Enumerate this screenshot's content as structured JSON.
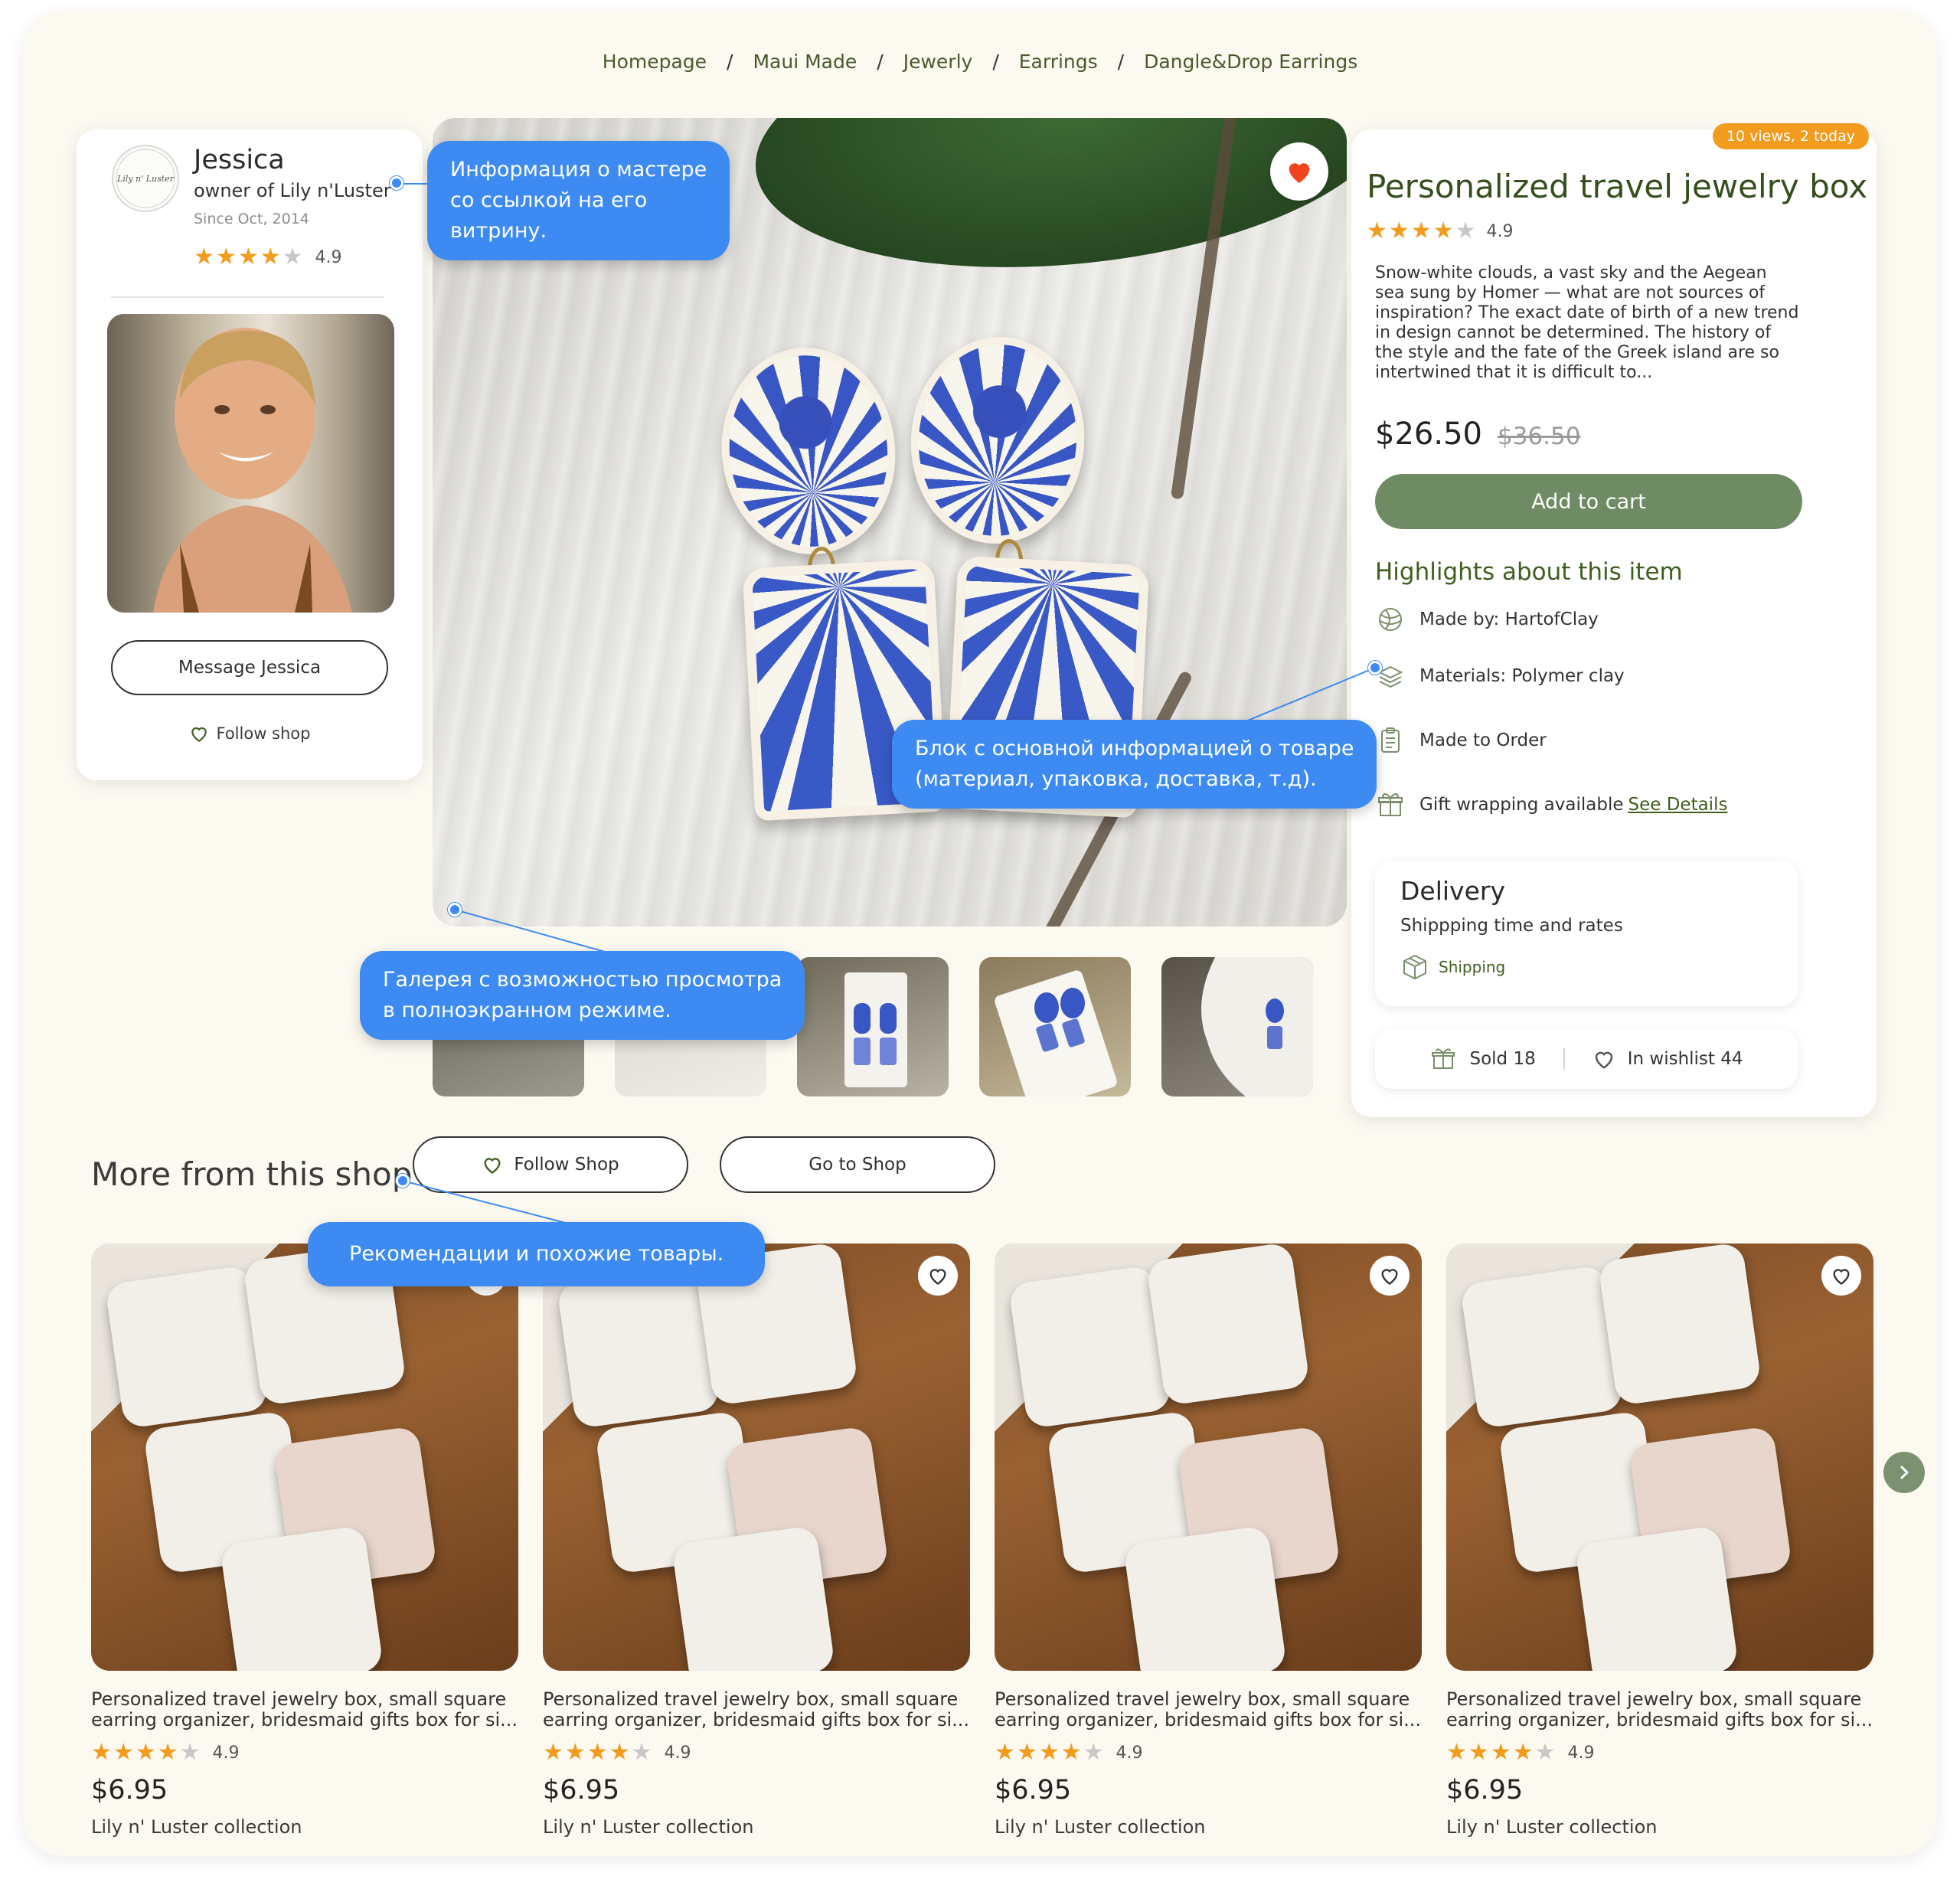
{
  "breadcrumb": [
    "Homepage",
    "Maui Made",
    "Jewerly",
    "Earrings",
    "Dangle&Drop Earrings"
  ],
  "breadcrumb_separator": "/",
  "seller": {
    "logo_text": "Lily n' Luster",
    "name": "Jessica",
    "owner": "owner of Lily n'Luster",
    "since": "Since Oct, 2014",
    "rating": "4.9",
    "stars": 4,
    "message_button": "Message Jessica",
    "follow_label": "Follow shop"
  },
  "product": {
    "views_badge": "10 views, 2 today",
    "title": "Personalized travel jewelry box",
    "rating": "4.9",
    "stars": 4,
    "description": "Snow-white clouds, a vast sky and the Aegean sea sung by Homer — what are not sources of inspiration? The exact date of birth of a new trend in design cannot be determined. The history of the style and the fate of the Greek island are so intertwined that it is difficult to...",
    "price": "$26.50",
    "old_price": "$36.50",
    "add_to_cart": "Add to cart",
    "highlights_title": "Highlights about this item",
    "highlights": [
      {
        "icon": "yarn-ball-icon",
        "text": "Made by: HartofClay"
      },
      {
        "icon": "layers-icon",
        "text": "Materials: Polymer clay"
      },
      {
        "icon": "clipboard-icon",
        "text": "Made to Order"
      },
      {
        "icon": "gift-icon",
        "text": "Gift wrapping available",
        "link": "See Details"
      }
    ],
    "delivery": {
      "title": "Delivery",
      "subtitle": "Shippping time and rates",
      "shipping_link": "Shipping"
    },
    "sold": "Sold 18",
    "wishlist": "In wishlist 44",
    "favorite_active": true
  },
  "more_from_shop": {
    "title": "More from this shop",
    "follow_button": "Follow Shop",
    "go_to_shop_button": "Go to Shop",
    "items": [
      {
        "name": "Personalized travel jewelry box, small square earring organizer, bridesmaid gifts box for si...",
        "rating": "4.9",
        "stars": 4,
        "price": "$6.95",
        "collection": "Lily n' Luster collection"
      },
      {
        "name": "Personalized travel jewelry box, small square earring organizer, bridesmaid gifts box for si...",
        "rating": "4.9",
        "stars": 4,
        "price": "$6.95",
        "collection": "Lily n' Luster collection"
      },
      {
        "name": "Personalized travel jewelry box, small square earring organizer, bridesmaid gifts box for si...",
        "rating": "4.9",
        "stars": 4,
        "price": "$6.95",
        "collection": "Lily n' Luster collection"
      },
      {
        "name": "Personalized travel jewelry box, small square earring organizer, bridesmaid gifts box for si...",
        "rating": "4.9",
        "stars": 4,
        "price": "$6.95",
        "collection": "Lily n' Luster collection"
      }
    ]
  },
  "annotations": {
    "seller_info": [
      "Информация о мастере",
      "со ссылкой на его",
      "витрину."
    ],
    "product_info": [
      "Блок с основной информацией о товаре",
      "(материал, упаковка, доставка, т.д)."
    ],
    "gallery": [
      "Галерея с возможностью просмотра",
      "в полноэкранном режиме."
    ],
    "recommendations": [
      "Рекомендации и похожие товары."
    ]
  },
  "colors": {
    "page_background": "#fcf9f1",
    "accent_green": "#3f5f1f",
    "button_green": "#6f8b63",
    "star": "#f29b1d",
    "badge_orange": "#f29b1d",
    "annotation_blue": "#3d8bf2",
    "favorite_red": "#f0441e"
  }
}
